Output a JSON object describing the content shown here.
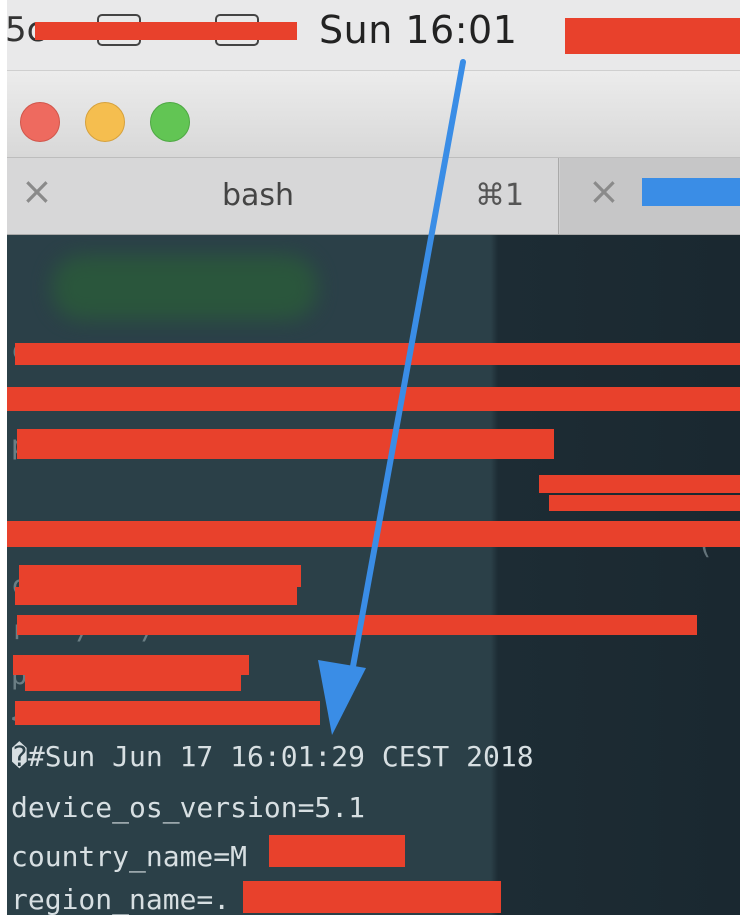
{
  "menubar": {
    "partial_left": "5c",
    "clock": "Sun 16:01"
  },
  "tabs": [
    {
      "close": "×",
      "title": "bash",
      "shortcut": "⌘1"
    },
    {
      "close": "×"
    }
  ],
  "terminal": {
    "ghost_text": [
      "c",
      "r",
      "p",
      "(",
      "c",
      "r   /   /",
      "p",
      "<"
    ],
    "lines": [
      "�#Sun Jun 17 16:01:29 CEST 2018",
      "device_os_version=5.1",
      "country_name=M",
      "region_name=."
    ]
  },
  "colors": {
    "redaction": "#e8412c",
    "annotation_arrow": "#3a8de6",
    "terminal_bg": "#2b4048"
  }
}
